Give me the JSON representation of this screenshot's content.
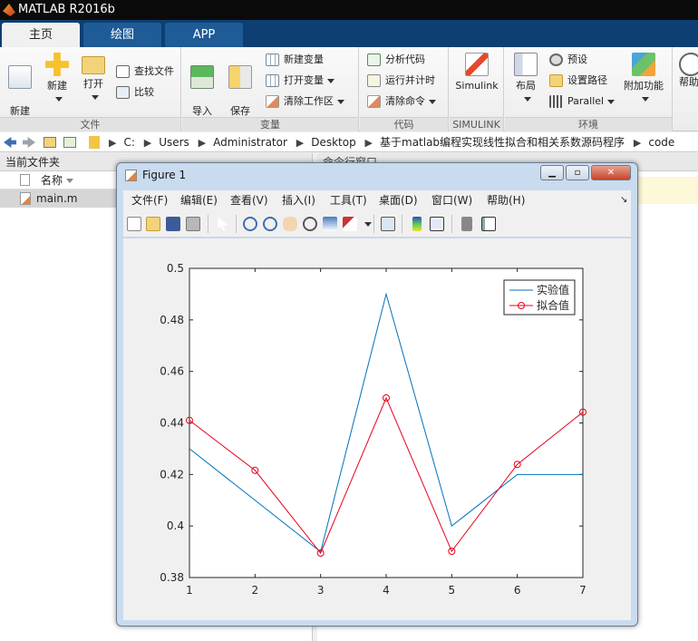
{
  "app": {
    "title": "MATLAB R2016b"
  },
  "tabs": [
    {
      "label": "主页"
    },
    {
      "label": "绘图"
    },
    {
      "label": "APP"
    }
  ],
  "ribbon": {
    "file": {
      "group_label": "文件",
      "new_script": "新建\n脚本",
      "new": "新建",
      "open": "打开",
      "find_files": "查找文件",
      "compare": "比较"
    },
    "variable": {
      "group_label": "变量",
      "import_data": "导入\n数据",
      "save_workspace": "保存\n工作区",
      "new_variable": "新建变量",
      "open_variable": "打开变量",
      "clear_workspace": "清除工作区"
    },
    "code": {
      "group_label": "代码",
      "analyze_code": "分析代码",
      "run_and_time": "运行并计时",
      "clear_commands": "清除命令"
    },
    "simulink": {
      "group_label": "SIMULINK",
      "simulink": "Simulink"
    },
    "environment": {
      "group_label": "环境",
      "layout": "布局",
      "preferences": "预设",
      "set_path": "设置路径",
      "parallel": "Parallel",
      "addons": "附加功能"
    },
    "resources": {
      "help": "帮助"
    }
  },
  "address": {
    "crumbs": [
      "C:",
      "Users",
      "Administrator",
      "Desktop",
      "基于matlab编程实现线性拟合和相关系数源码程序",
      "code"
    ]
  },
  "file_browser": {
    "title": "当前文件夹",
    "column_name": "名称",
    "files": [
      "main.m"
    ]
  },
  "command_window": {
    "title": "命令行窗口"
  },
  "figure": {
    "title": "Figure 1",
    "menu": [
      "文件(F)",
      "编辑(E)",
      "查看(V)",
      "插入(I)",
      "工具(T)",
      "桌面(D)",
      "窗口(W)",
      "帮助(H)"
    ]
  },
  "colors": {
    "ribbon_tab_bg": "#0d3f73",
    "series_experimental": "#0072bd",
    "series_fitted": "#e8001c"
  },
  "chart_data": {
    "type": "line",
    "x": [
      1,
      2,
      3,
      4,
      5,
      6,
      7
    ],
    "series": [
      {
        "name": "实验值",
        "values": [
          0.43,
          0.41,
          0.39,
          0.49,
          0.4,
          0.42,
          0.42
        ],
        "marker": "none"
      },
      {
        "name": "拟合值",
        "values": [
          0.441,
          0.4216,
          0.3895,
          0.4497,
          0.3902,
          0.4239,
          0.4442
        ],
        "marker": "circle"
      }
    ],
    "xlim": [
      1,
      7
    ],
    "ylim": [
      0.38,
      0.5
    ],
    "xticks": [
      "1",
      "2",
      "3",
      "4",
      "5",
      "6",
      "7"
    ],
    "yticks": [
      "0.38",
      "0.4",
      "0.42",
      "0.44",
      "0.46",
      "0.48",
      "0.5"
    ],
    "legend_position": "top-right",
    "grid": false
  }
}
